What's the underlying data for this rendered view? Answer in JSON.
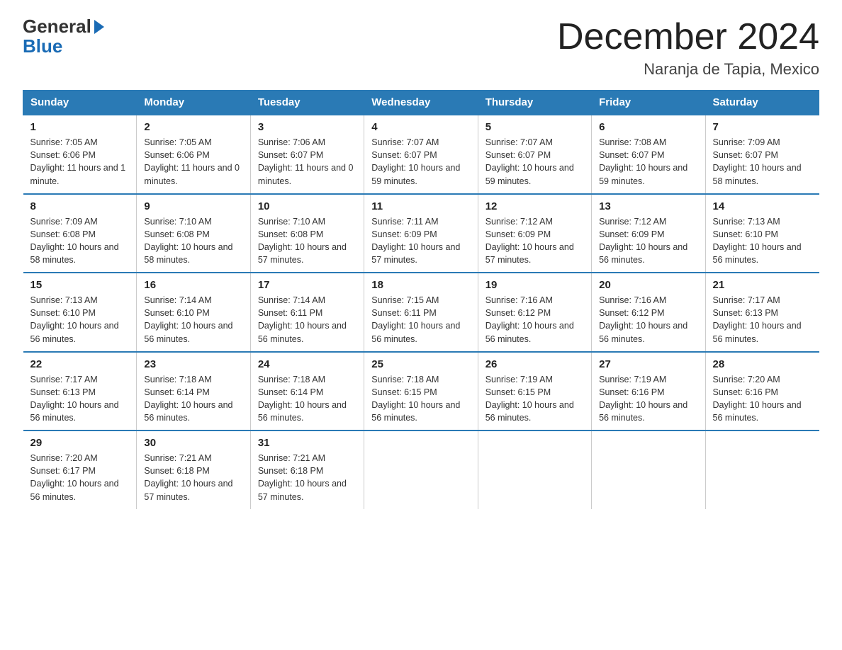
{
  "logo": {
    "general": "General",
    "blue": "Blue"
  },
  "title": "December 2024",
  "location": "Naranja de Tapia, Mexico",
  "headers": [
    "Sunday",
    "Monday",
    "Tuesday",
    "Wednesday",
    "Thursday",
    "Friday",
    "Saturday"
  ],
  "weeks": [
    [
      {
        "day": "1",
        "sunrise": "7:05 AM",
        "sunset": "6:06 PM",
        "daylight": "11 hours and 1 minute."
      },
      {
        "day": "2",
        "sunrise": "7:05 AM",
        "sunset": "6:06 PM",
        "daylight": "11 hours and 0 minutes."
      },
      {
        "day": "3",
        "sunrise": "7:06 AM",
        "sunset": "6:07 PM",
        "daylight": "11 hours and 0 minutes."
      },
      {
        "day": "4",
        "sunrise": "7:07 AM",
        "sunset": "6:07 PM",
        "daylight": "10 hours and 59 minutes."
      },
      {
        "day": "5",
        "sunrise": "7:07 AM",
        "sunset": "6:07 PM",
        "daylight": "10 hours and 59 minutes."
      },
      {
        "day": "6",
        "sunrise": "7:08 AM",
        "sunset": "6:07 PM",
        "daylight": "10 hours and 59 minutes."
      },
      {
        "day": "7",
        "sunrise": "7:09 AM",
        "sunset": "6:07 PM",
        "daylight": "10 hours and 58 minutes."
      }
    ],
    [
      {
        "day": "8",
        "sunrise": "7:09 AM",
        "sunset": "6:08 PM",
        "daylight": "10 hours and 58 minutes."
      },
      {
        "day": "9",
        "sunrise": "7:10 AM",
        "sunset": "6:08 PM",
        "daylight": "10 hours and 58 minutes."
      },
      {
        "day": "10",
        "sunrise": "7:10 AM",
        "sunset": "6:08 PM",
        "daylight": "10 hours and 57 minutes."
      },
      {
        "day": "11",
        "sunrise": "7:11 AM",
        "sunset": "6:09 PM",
        "daylight": "10 hours and 57 minutes."
      },
      {
        "day": "12",
        "sunrise": "7:12 AM",
        "sunset": "6:09 PM",
        "daylight": "10 hours and 57 minutes."
      },
      {
        "day": "13",
        "sunrise": "7:12 AM",
        "sunset": "6:09 PM",
        "daylight": "10 hours and 56 minutes."
      },
      {
        "day": "14",
        "sunrise": "7:13 AM",
        "sunset": "6:10 PM",
        "daylight": "10 hours and 56 minutes."
      }
    ],
    [
      {
        "day": "15",
        "sunrise": "7:13 AM",
        "sunset": "6:10 PM",
        "daylight": "10 hours and 56 minutes."
      },
      {
        "day": "16",
        "sunrise": "7:14 AM",
        "sunset": "6:10 PM",
        "daylight": "10 hours and 56 minutes."
      },
      {
        "day": "17",
        "sunrise": "7:14 AM",
        "sunset": "6:11 PM",
        "daylight": "10 hours and 56 minutes."
      },
      {
        "day": "18",
        "sunrise": "7:15 AM",
        "sunset": "6:11 PM",
        "daylight": "10 hours and 56 minutes."
      },
      {
        "day": "19",
        "sunrise": "7:16 AM",
        "sunset": "6:12 PM",
        "daylight": "10 hours and 56 minutes."
      },
      {
        "day": "20",
        "sunrise": "7:16 AM",
        "sunset": "6:12 PM",
        "daylight": "10 hours and 56 minutes."
      },
      {
        "day": "21",
        "sunrise": "7:17 AM",
        "sunset": "6:13 PM",
        "daylight": "10 hours and 56 minutes."
      }
    ],
    [
      {
        "day": "22",
        "sunrise": "7:17 AM",
        "sunset": "6:13 PM",
        "daylight": "10 hours and 56 minutes."
      },
      {
        "day": "23",
        "sunrise": "7:18 AM",
        "sunset": "6:14 PM",
        "daylight": "10 hours and 56 minutes."
      },
      {
        "day": "24",
        "sunrise": "7:18 AM",
        "sunset": "6:14 PM",
        "daylight": "10 hours and 56 minutes."
      },
      {
        "day": "25",
        "sunrise": "7:18 AM",
        "sunset": "6:15 PM",
        "daylight": "10 hours and 56 minutes."
      },
      {
        "day": "26",
        "sunrise": "7:19 AM",
        "sunset": "6:15 PM",
        "daylight": "10 hours and 56 minutes."
      },
      {
        "day": "27",
        "sunrise": "7:19 AM",
        "sunset": "6:16 PM",
        "daylight": "10 hours and 56 minutes."
      },
      {
        "day": "28",
        "sunrise": "7:20 AM",
        "sunset": "6:16 PM",
        "daylight": "10 hours and 56 minutes."
      }
    ],
    [
      {
        "day": "29",
        "sunrise": "7:20 AM",
        "sunset": "6:17 PM",
        "daylight": "10 hours and 56 minutes."
      },
      {
        "day": "30",
        "sunrise": "7:21 AM",
        "sunset": "6:18 PM",
        "daylight": "10 hours and 57 minutes."
      },
      {
        "day": "31",
        "sunrise": "7:21 AM",
        "sunset": "6:18 PM",
        "daylight": "10 hours and 57 minutes."
      },
      null,
      null,
      null,
      null
    ]
  ],
  "labels": {
    "sunrise": "Sunrise:",
    "sunset": "Sunset:",
    "daylight": "Daylight:"
  }
}
